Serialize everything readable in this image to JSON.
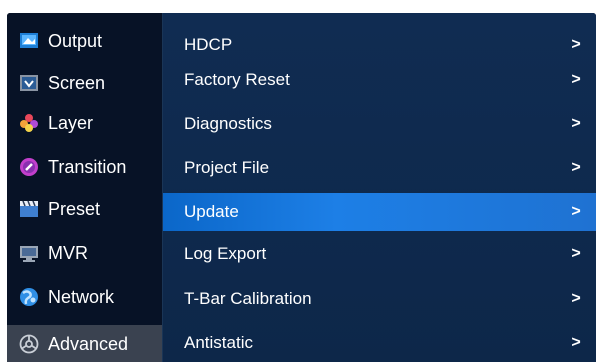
{
  "sidebar": {
    "items": [
      {
        "label": "Output",
        "icon": "output-icon"
      },
      {
        "label": "Screen",
        "icon": "screen-icon"
      },
      {
        "label": "Layer",
        "icon": "layer-icon"
      },
      {
        "label": "Transition",
        "icon": "transition-icon"
      },
      {
        "label": "Preset",
        "icon": "preset-icon"
      },
      {
        "label": "MVR",
        "icon": "mvr-icon"
      },
      {
        "label": "Network",
        "icon": "network-icon"
      },
      {
        "label": "Advanced",
        "icon": "advanced-icon",
        "selected": true
      }
    ]
  },
  "submenu": {
    "chevron": ">",
    "items": [
      {
        "label": "HDCP"
      },
      {
        "label": "Factory Reset"
      },
      {
        "label": "Diagnostics"
      },
      {
        "label": "Project File"
      },
      {
        "label": "Update",
        "highlighted": true
      },
      {
        "label": "Log Export"
      },
      {
        "label": "T-Bar Calibration"
      },
      {
        "label": "Antistatic"
      }
    ]
  },
  "colors": {
    "highlight": "#1a78e0",
    "selected_sidebar": "#3a4250",
    "panel": "#102c52"
  }
}
